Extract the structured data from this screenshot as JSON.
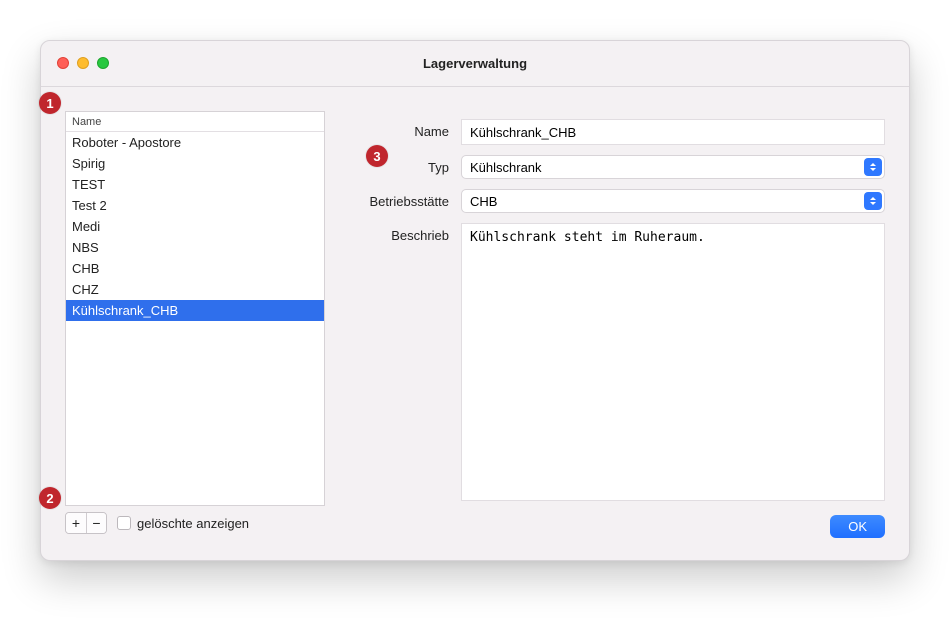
{
  "window": {
    "title": "Lagerverwaltung"
  },
  "list": {
    "header": "Name",
    "items": [
      {
        "label": "Roboter - Apostore",
        "selected": false
      },
      {
        "label": "Spirig",
        "selected": false
      },
      {
        "label": "TEST",
        "selected": false
      },
      {
        "label": "Test 2",
        "selected": false
      },
      {
        "label": "Medi",
        "selected": false
      },
      {
        "label": "NBS",
        "selected": false
      },
      {
        "label": "CHB",
        "selected": false
      },
      {
        "label": "CHZ",
        "selected": false
      },
      {
        "label": "Kühlschrank_CHB",
        "selected": true
      }
    ],
    "showDeletedLabel": "gelöschte anzeigen",
    "addGlyph": "+",
    "removeGlyph": "−"
  },
  "form": {
    "labels": {
      "name": "Name",
      "type": "Typ",
      "site": "Betriebsstätte",
      "desc": "Beschrieb"
    },
    "name": "Kühlschrank_CHB",
    "type": "Kühlschrank",
    "site": "CHB",
    "desc": "Kühlschrank steht im Ruheraum."
  },
  "buttons": {
    "ok": "OK"
  },
  "markers": {
    "one": "1",
    "two": "2",
    "three": "3"
  }
}
